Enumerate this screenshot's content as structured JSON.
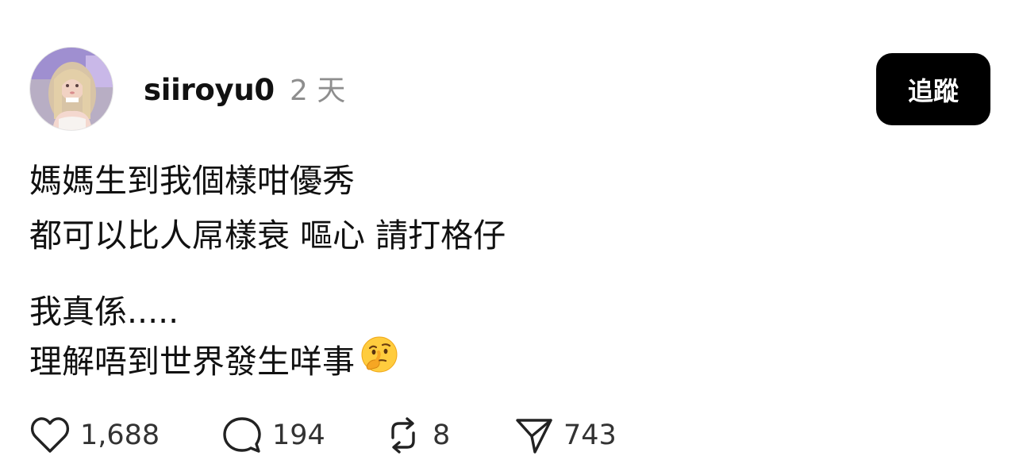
{
  "post": {
    "username": "siiroyu0",
    "timestamp": "2 天",
    "follow_label": "追蹤",
    "lines": [
      "媽媽生到我個樣咁優秀",
      "都可以比人屌樣衰 嘔心 請打格仔",
      "我真係.....",
      "理解唔到世界發生咩事"
    ],
    "emoji": "thinking-face"
  },
  "actions": {
    "likes": "1,688",
    "comments": "194",
    "reposts": "8",
    "shares": "743"
  },
  "colors": {
    "text": "#111111",
    "muted": "#8e8e8e",
    "button_bg": "#000000",
    "button_text": "#ffffff"
  }
}
